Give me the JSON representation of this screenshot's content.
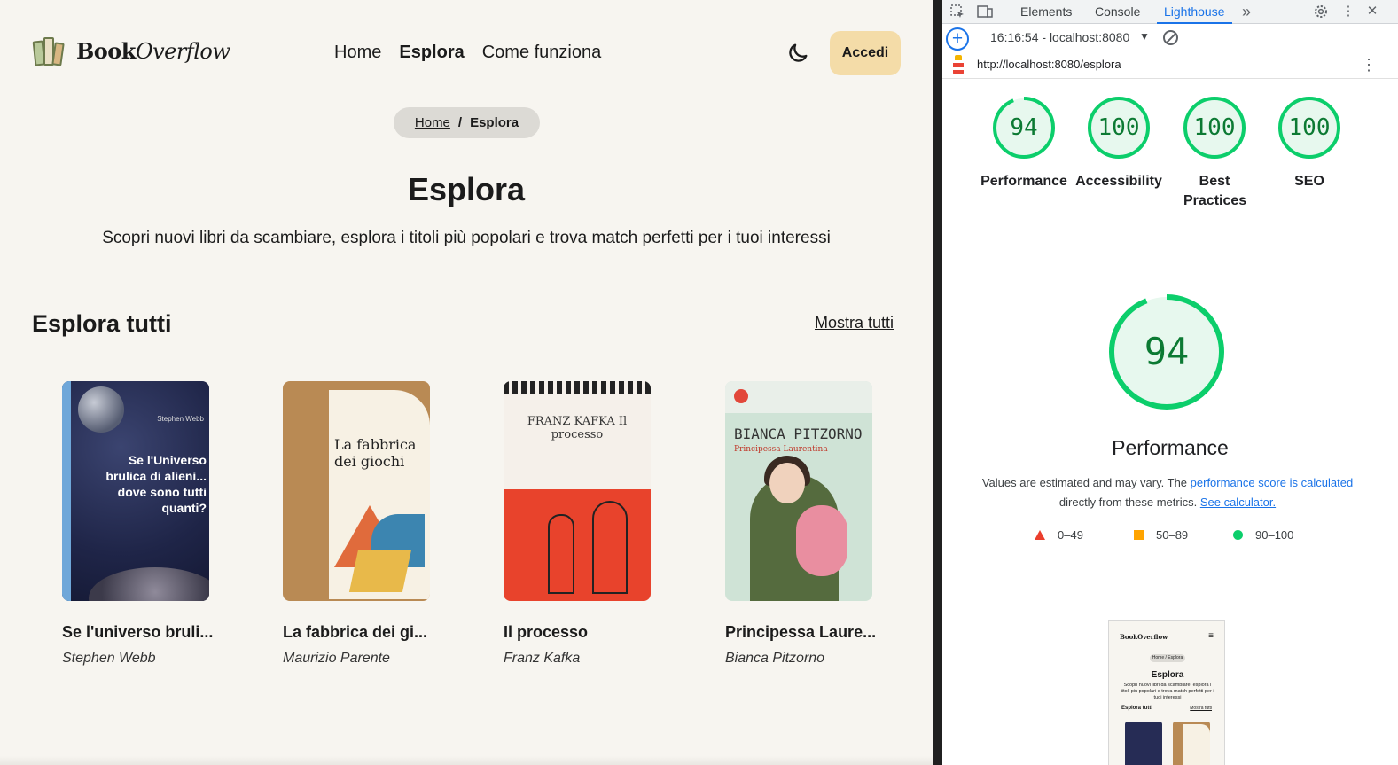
{
  "site": {
    "logo": {
      "bold": "Book",
      "italic": "Overflow"
    },
    "nav": [
      {
        "label": "Home",
        "active": false
      },
      {
        "label": "Esplora",
        "active": true
      },
      {
        "label": "Come funziona",
        "active": false
      }
    ],
    "login_label": "Accedi",
    "breadcrumb": {
      "home": "Home",
      "separator": "/",
      "current": "Esplora"
    },
    "title": "Esplora",
    "subtitle": "Scopri nuovi libri da scambiare, esplora i titoli più popolari e trova match perfetti per i tuoi interessi",
    "section": {
      "title": "Esplora tutti",
      "show_all": "Mostra tutti"
    },
    "books": [
      {
        "title": "Se l'universo bruli...",
        "author": "Stephen Webb",
        "cover_author": "Stephen Webb",
        "cover_title": "Se l'Universo brulica di alieni... dove sono tutti quanti?"
      },
      {
        "title": "La fabbrica dei gi...",
        "author": "Maurizio Parente",
        "cover_title": "La fabbrica dei giochi"
      },
      {
        "title": "Il processo",
        "author": "Franz Kafka",
        "cover_title": "FRANZ KAFKA Il processo"
      },
      {
        "title": "Principessa Laure...",
        "author": "Bianca Pitzorno",
        "cover_author": "BIANCA PITZORNO",
        "cover_title": "Principessa Laurentina"
      }
    ]
  },
  "devtools": {
    "tabs": [
      {
        "label": "Elements",
        "active": false
      },
      {
        "label": "Console",
        "active": false
      },
      {
        "label": "Lighthouse",
        "active": true
      }
    ],
    "more_tabs": "»",
    "session": "16:16:54 - localhost:8080",
    "url": "http://localhost:8080/esplora",
    "scores": [
      {
        "value": "94",
        "label": "Performance",
        "fraction": 0.94
      },
      {
        "value": "100",
        "label": "Accessibility",
        "fraction": 1.0
      },
      {
        "value": "100",
        "label": "Best Practices",
        "fraction": 1.0
      },
      {
        "value": "100",
        "label": "SEO",
        "fraction": 1.0
      }
    ],
    "performance": {
      "score": "94",
      "title": "Performance",
      "desc_pre": "Values are estimated and may vary. The ",
      "desc_link1": "performance score is calculated",
      "desc_mid": " directly from these metrics. ",
      "desc_link2": "See calculator."
    },
    "legend": [
      {
        "range": "0–49",
        "shape": "triangle",
        "color": "#eb3e2d"
      },
      {
        "range": "50–89",
        "shape": "square",
        "color": "#ffa400"
      },
      {
        "range": "90–100",
        "shape": "circle",
        "color": "#0cce6b"
      }
    ],
    "thumbnail": {
      "logo": "BookOverflow",
      "crumb": "Home / Esplora",
      "title": "Esplora",
      "subtitle": "Scopri nuovi libri da scambiare, esplora i titoli più popolari e trova match perfetti per i tuoi interessi",
      "section": "Esplora tutti",
      "show_all": "Mostra tutti"
    },
    "colors": {
      "pass": "#0cce6b",
      "pass_text": "#0c7a33",
      "link": "#1a73e8"
    }
  }
}
